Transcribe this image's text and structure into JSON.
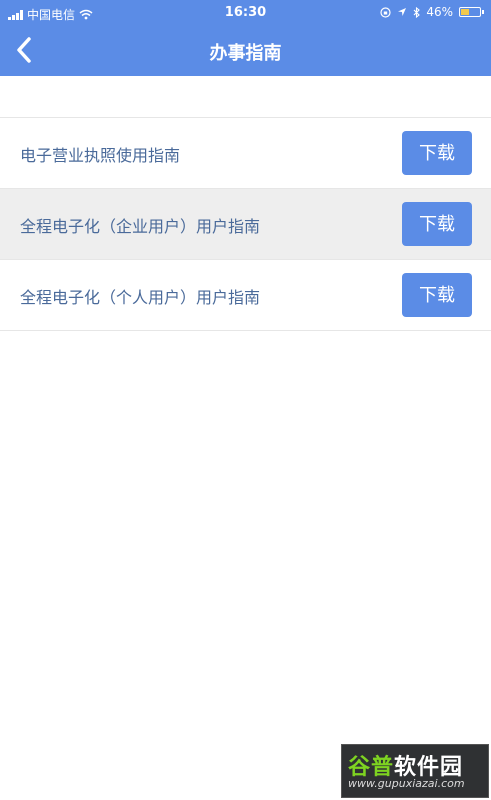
{
  "status_bar": {
    "carrier": "中国电信",
    "time": "16:30",
    "battery_text": "46%",
    "battery_level": 0.46,
    "icons": [
      "signal-icon",
      "wifi-icon",
      "lock-rotation-icon",
      "location-icon",
      "bluetooth-icon",
      "battery-icon"
    ]
  },
  "nav": {
    "back_icon": "chevron-left-icon",
    "title": "办事指南"
  },
  "guides": [
    {
      "label": "电子营业执照使用指南",
      "button": "下载"
    },
    {
      "label": "全程电子化（企业用户）用户指南",
      "button": "下载"
    },
    {
      "label": "全程电子化（个人用户）用户指南",
      "button": "下载"
    }
  ],
  "watermark": {
    "title_part1": "谷普",
    "title_part2": "软件园",
    "url": "www.gupuxiazai.com"
  },
  "colors": {
    "accent": "#5b8ce6",
    "label_text": "#4a6a9a",
    "highlight_row": "#eeeeee"
  }
}
